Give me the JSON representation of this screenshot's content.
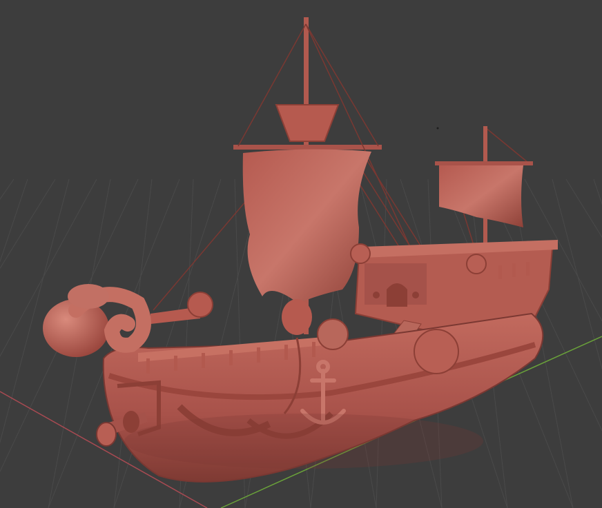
{
  "viewport": {
    "background_color": "#3d3d3d",
    "grid_color": "#4a4a4a",
    "x_axis_color": "#a84a52",
    "y_axis_color": "#6aa23a"
  },
  "model": {
    "material_color": "#b65a4f",
    "shadow_color": "#8c3f36",
    "highlight_color": "#d07a6c"
  },
  "icons": {
    "anchor": "anchor-icon"
  }
}
